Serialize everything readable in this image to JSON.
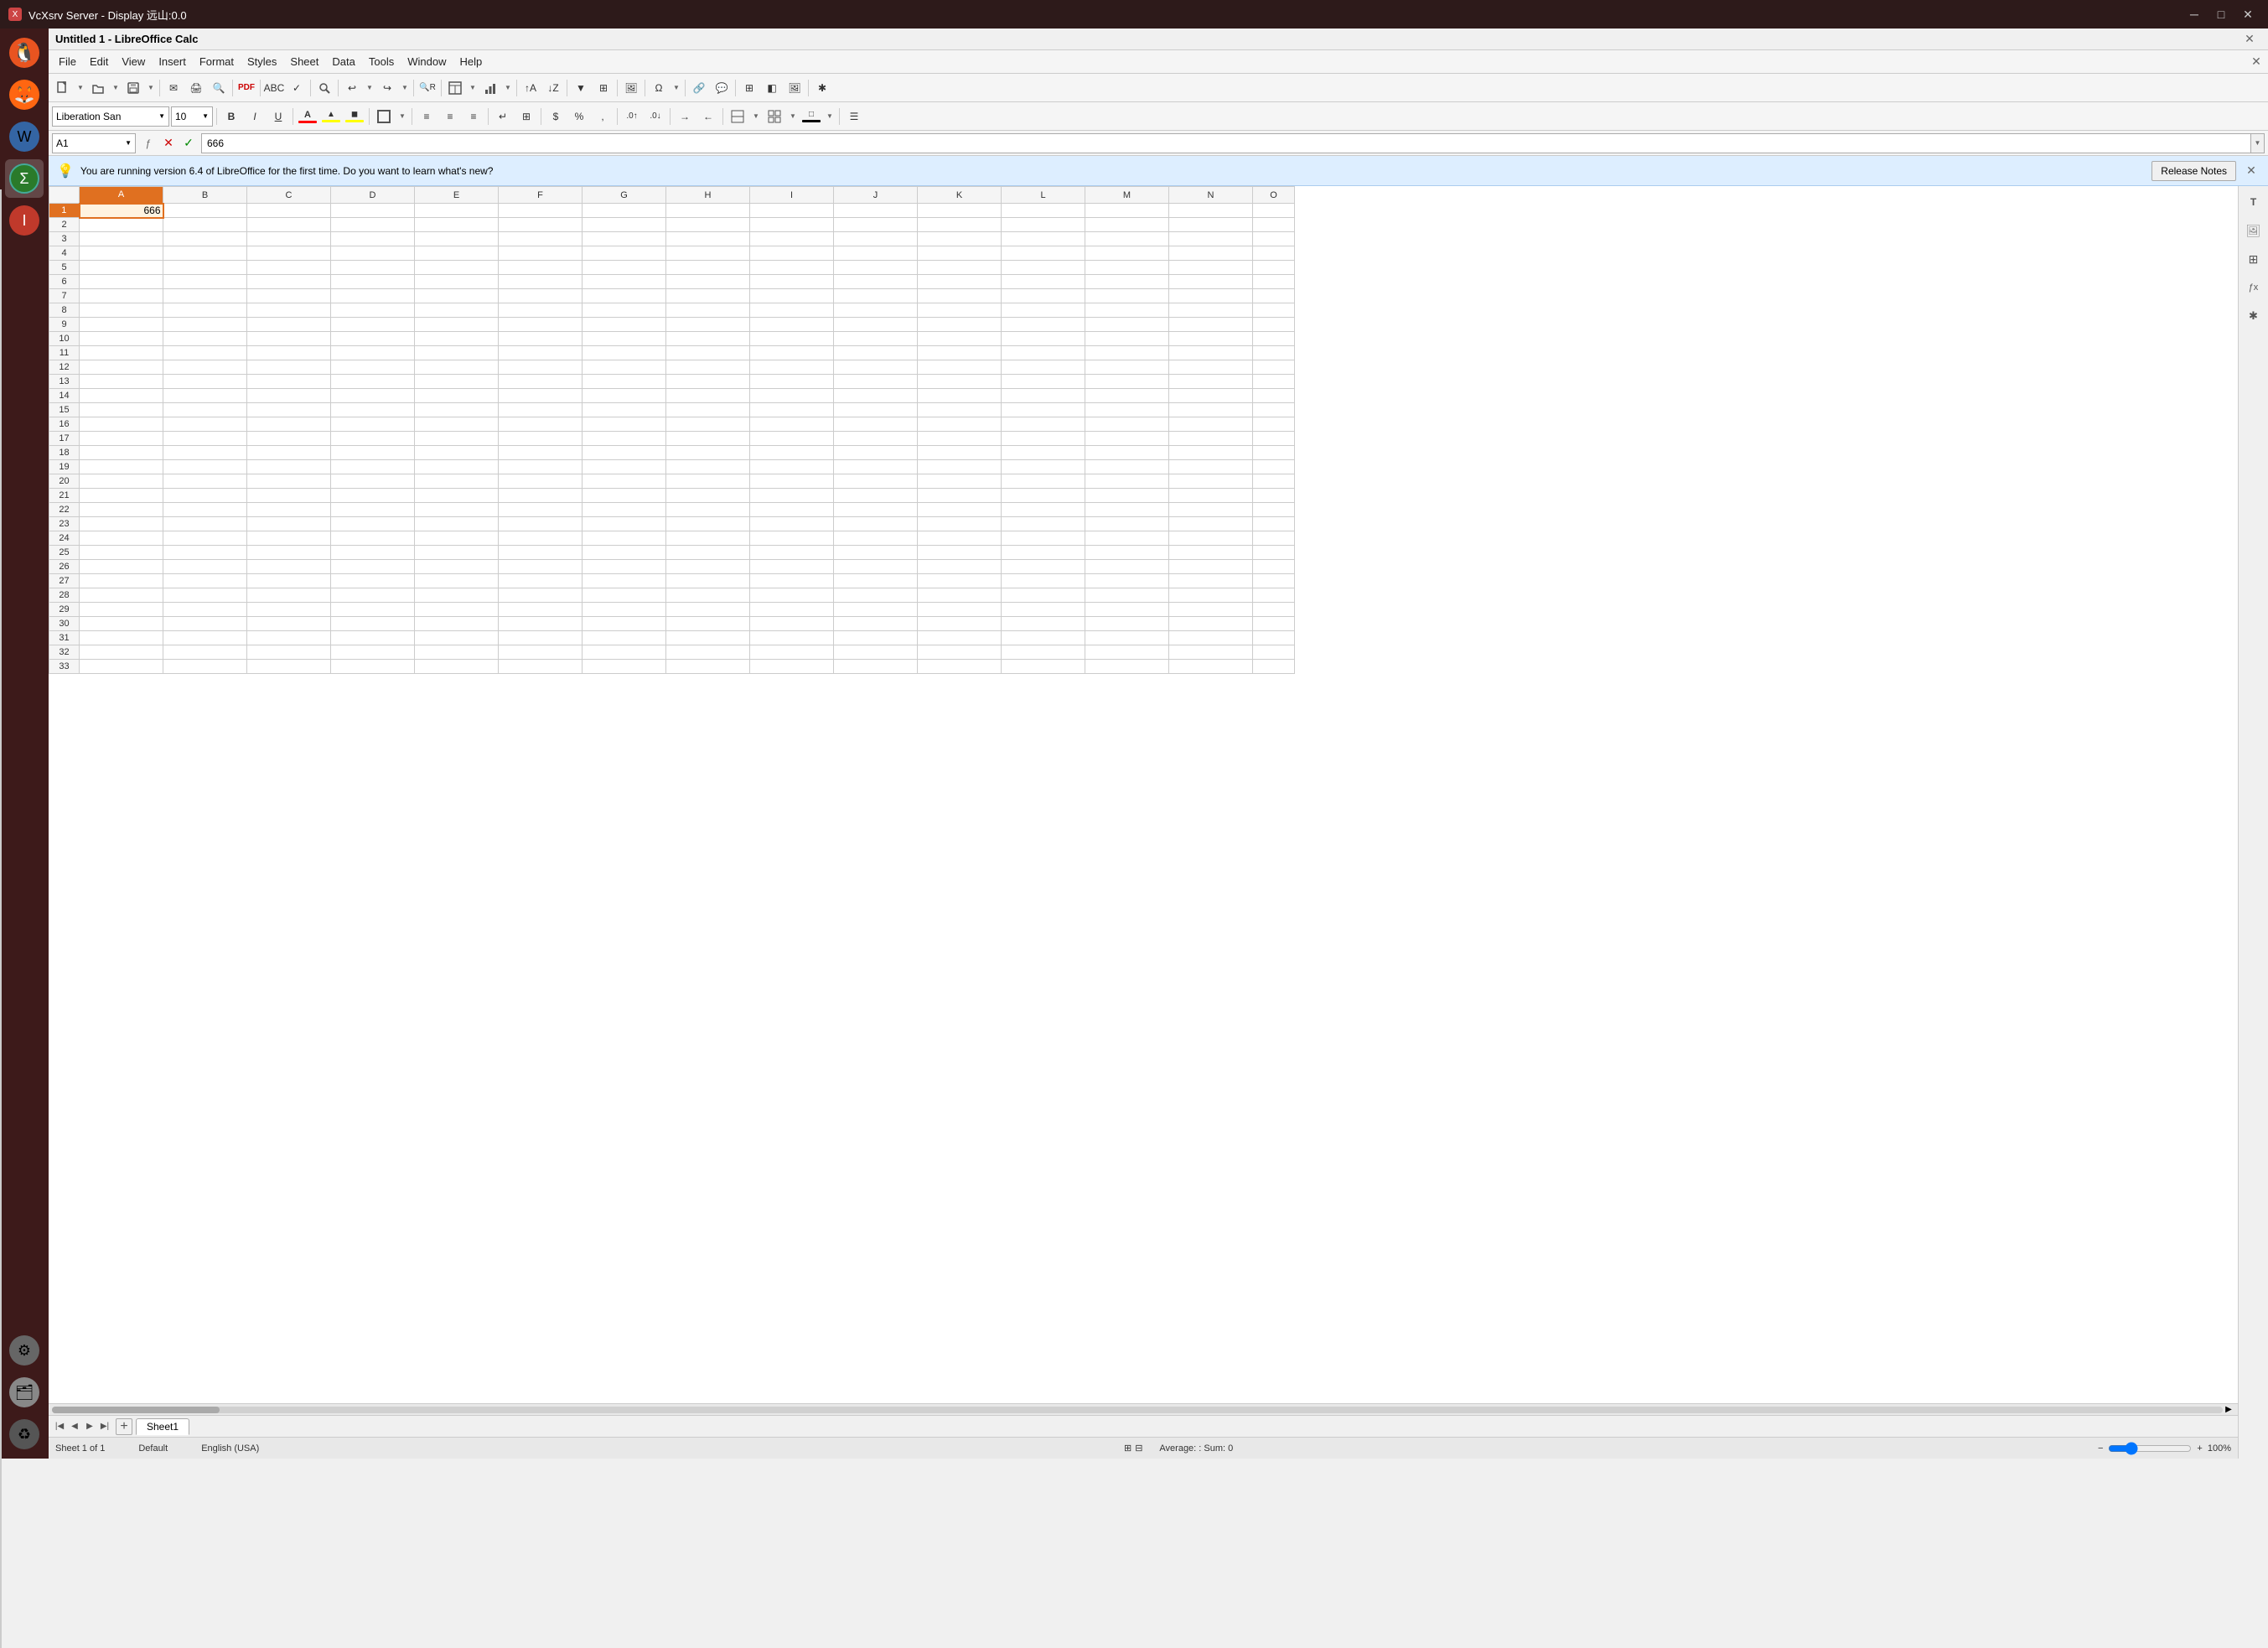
{
  "window": {
    "title": "VcXsrv Server - Display 远山:0.0",
    "app_title": "Untitled 1 - LibreOffice Calc"
  },
  "titlebar": {
    "minimize": "─",
    "maximize": "□",
    "close": "✕"
  },
  "menu": {
    "items": [
      "File",
      "Edit",
      "View",
      "Insert",
      "Format",
      "Styles",
      "Sheet",
      "Data",
      "Tools",
      "Window",
      "Help"
    ]
  },
  "formula_bar": {
    "cell_ref": "A1",
    "cell_value": "666"
  },
  "font": {
    "name": "Liberation San",
    "size": "10"
  },
  "info_bar": {
    "message": "You are running version 6.4 of LibreOffice for the first time. Do you want to learn what's new?",
    "release_notes_btn": "Release Notes"
  },
  "columns": [
    "A",
    "B",
    "C",
    "D",
    "E",
    "F",
    "G",
    "H",
    "I",
    "J",
    "K",
    "L",
    "M",
    "N",
    "O"
  ],
  "rows": [
    1,
    2,
    3,
    4,
    5,
    6,
    7,
    8,
    9,
    10,
    11,
    12,
    13,
    14,
    15,
    16,
    17,
    18,
    19,
    20,
    21,
    22,
    23,
    24,
    25,
    26,
    27,
    28,
    29,
    30,
    31,
    32,
    33
  ],
  "cell_a1_value": "666",
  "sheet_tabs": [
    "Sheet1"
  ],
  "status_bar": {
    "left": "Sheet 1 of 1",
    "middle": "Default",
    "language": "English (USA)",
    "formula": "Average: : Sum: 0",
    "zoom": "100%"
  },
  "toolbar1": {
    "buttons": [
      "new",
      "open",
      "save",
      "email",
      "print",
      "print-preview",
      "export-pdf",
      "spellcheck",
      "autospellcheck",
      "find",
      "undo",
      "redo",
      "find-replace",
      "start-center",
      "insert-table",
      "insert-chart",
      "sort-asc",
      "sort-desc",
      "navigator",
      "autofilter",
      "stdfilter",
      "insert-image",
      "insert-chart2",
      "insert-form",
      "special-char",
      "insert-text",
      "footnote",
      "pagebreak",
      "styles",
      "gallery",
      "basic"
    ]
  },
  "right_sidebar": {
    "items": [
      "styles-icon",
      "gallery-icon",
      "navigator-icon",
      "functions-icon",
      "macro-icon"
    ]
  }
}
